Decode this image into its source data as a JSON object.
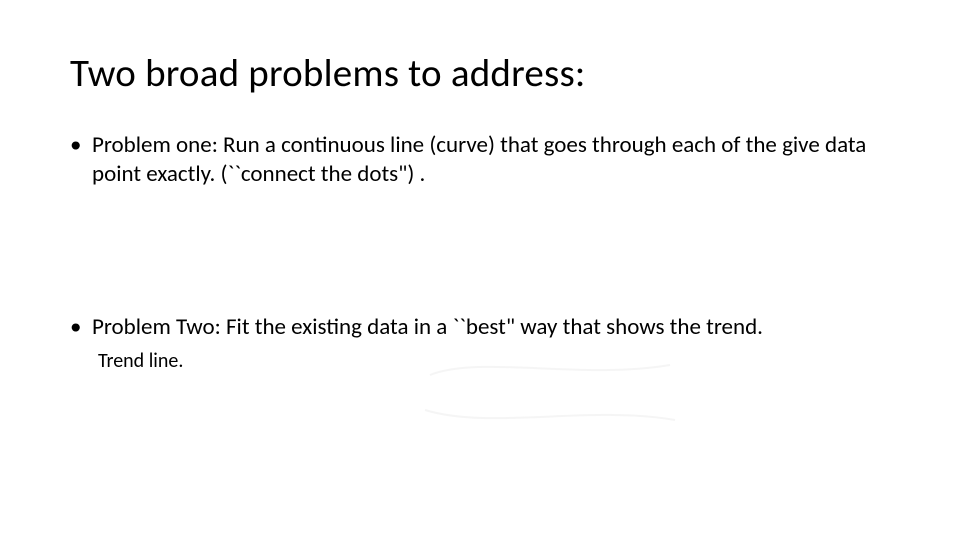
{
  "title": "Two broad problems to address:",
  "bullets": [
    "Problem one:   Run a continuous line (curve) that goes through each of the give data point exactly. (``connect the dots\") .",
    "Problem Two: Fit the existing data in a ``best\" way that shows the trend."
  ],
  "subline": "Trend line."
}
